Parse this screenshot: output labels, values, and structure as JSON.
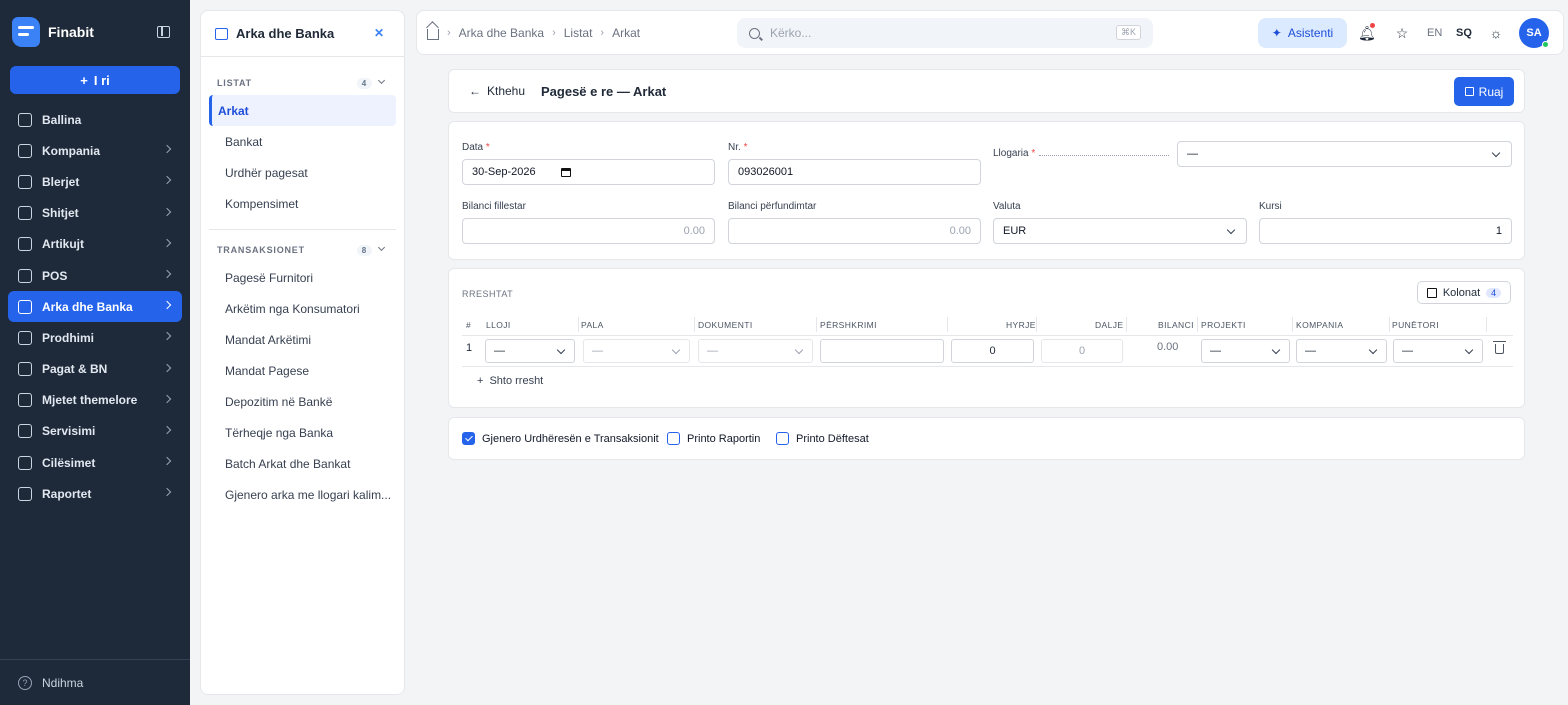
{
  "app": {
    "name": "Finabit",
    "new_button": "I ri",
    "help": "Ndihma"
  },
  "nav": [
    {
      "label": "Ballina",
      "icon": "dashboard-icon",
      "chevron": false,
      "active": false
    },
    {
      "label": "Kompania",
      "icon": "building-icon",
      "chevron": true,
      "active": false
    },
    {
      "label": "Blerjet",
      "icon": "truck-icon",
      "chevron": true,
      "active": false
    },
    {
      "label": "Shitjet",
      "icon": "bag-icon",
      "chevron": true,
      "active": false
    },
    {
      "label": "Artikujt",
      "icon": "box-icon",
      "chevron": true,
      "active": false
    },
    {
      "label": "POS",
      "icon": "store-icon",
      "chevron": true,
      "active": false
    },
    {
      "label": "Arka dhe Banka",
      "icon": "wallet-icon",
      "chevron": true,
      "active": true
    },
    {
      "label": "Prodhimi",
      "icon": "factory-icon",
      "chevron": true,
      "active": false
    },
    {
      "label": "Pagat & BN",
      "icon": "coins-icon",
      "chevron": true,
      "active": false
    },
    {
      "label": "Mjetet themelore",
      "icon": "assets-icon",
      "chevron": true,
      "active": false
    },
    {
      "label": "Servisimi",
      "icon": "wrench-icon",
      "chevron": true,
      "active": false
    },
    {
      "label": "Cilësimet",
      "icon": "gear-icon",
      "chevron": true,
      "active": false
    },
    {
      "label": "Raportet",
      "icon": "chart-icon",
      "chevron": true,
      "active": false
    }
  ],
  "subpanel": {
    "title": "Arka dhe Banka",
    "lists": {
      "title": "LISTAT",
      "count": "4",
      "items": [
        "Arkat",
        "Bankat",
        "Urdhër pagesat",
        "Kompensimet"
      ],
      "selected": 0
    },
    "transactions": {
      "title": "TRANSAKSIONET",
      "count": "8",
      "items": [
        "Pagesë Furnitori",
        "Arkëtim nga Konsumatori",
        "Mandat Arkëtimi",
        "Mandat Pagese",
        "Depozitim në Bankë",
        "Tërheqje nga Banka",
        "Batch Arkat dhe Bankat",
        "Gjenero arka me llogari kalim..."
      ]
    }
  },
  "topbar": {
    "breadcrumbs": [
      "Arka dhe Banka",
      "Listat",
      "Arkat"
    ],
    "search_placeholder": "Kërko...",
    "shortcut": "⌘K",
    "assistant": "Asistenti",
    "lang_en": "EN",
    "lang_sq": "SQ",
    "avatar": "SA"
  },
  "header": {
    "back": "Kthehu",
    "title": "Pagesë e re — Arkat",
    "save": "Ruaj"
  },
  "form": {
    "date_label": "Data",
    "date_value": "30-Sep-2026",
    "nr_label": "Nr.",
    "nr_value": "093026001",
    "account_label": "Llogaria",
    "account_value": "—",
    "opening_label": "Bilanci fillestar",
    "opening_value": "0.00",
    "closing_label": "Bilanci përfundimtar",
    "closing_value": "0.00",
    "currency_label": "Valuta",
    "currency_value": "EUR",
    "rate_label": "Kursi",
    "rate_value": "1"
  },
  "rows": {
    "title": "RRESHTAT",
    "columns_button": "Kolonat",
    "columns_count": "4",
    "headers": [
      "#",
      "LLOJI",
      "PALA",
      "DOKUMENTI",
      "PËRSHKRIMI",
      "HYRJE",
      "DALJE",
      "BILANCI",
      "PROJEKTI",
      "KOMPANIA",
      "PUNËTORI"
    ],
    "row": {
      "index": "1",
      "type": "—",
      "party": "—",
      "document": "—",
      "description": "",
      "in": "0",
      "out": "0",
      "balance": "0.00",
      "project": "—",
      "company": "—",
      "employee": "—"
    },
    "add_row": "Shto rresht"
  },
  "options": [
    {
      "label": "Gjenero Urdhëresën e Transaksionit",
      "checked": true
    },
    {
      "label": "Printo Raportin",
      "checked": false
    },
    {
      "label": "Printo Dëftesat",
      "checked": false
    }
  ],
  "colors": {
    "sidebar": "#1e2939",
    "accent": "#2563eb",
    "success": "#22c55e",
    "danger": "#ef4444"
  }
}
